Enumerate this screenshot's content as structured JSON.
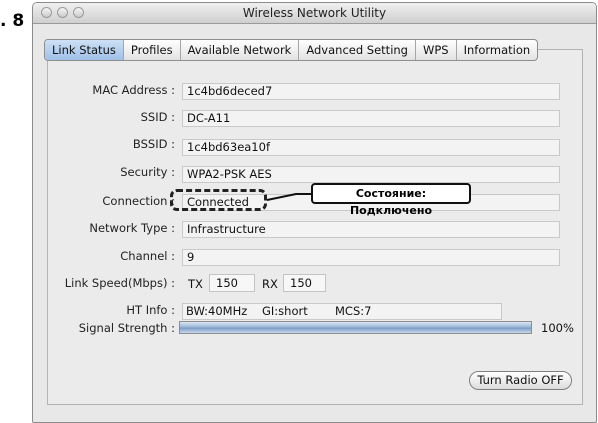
{
  "figure_label": ". 8",
  "window": {
    "title": "Wireless Network Utility"
  },
  "tabs": [
    "Link Status",
    "Profiles",
    "Available Network",
    "Advanced Setting",
    "WPS",
    "Information"
  ],
  "labels": {
    "mac": "MAC Address :",
    "ssid": "SSID :",
    "bssid": "BSSID :",
    "security": "Security :",
    "connection": "Connection :",
    "network_type": "Network Type :",
    "channel": "Channel :",
    "link_speed": "Link Speed(Mbps) :",
    "ht_info": "HT Info :",
    "signal": "Signal Strength :"
  },
  "values": {
    "mac": "1c4bd6deced7",
    "ssid": "DC-A11",
    "bssid": "1c4bd63ea10f",
    "security": "WPA2-PSK AES",
    "connection": "Connected",
    "network_type": "Infrastructure",
    "channel": "9"
  },
  "link_speed": {
    "tx_label": "TX",
    "tx": "150",
    "rx_label": "RX",
    "rx": "150"
  },
  "ht_info": {
    "bw": "BW:40MHz",
    "gi": "GI:short",
    "mcs": "MCS:7"
  },
  "signal": {
    "percent": 100,
    "text": "100%"
  },
  "button": {
    "radio": "Turn Radio OFF"
  },
  "callout": "Состояние: Подключено"
}
